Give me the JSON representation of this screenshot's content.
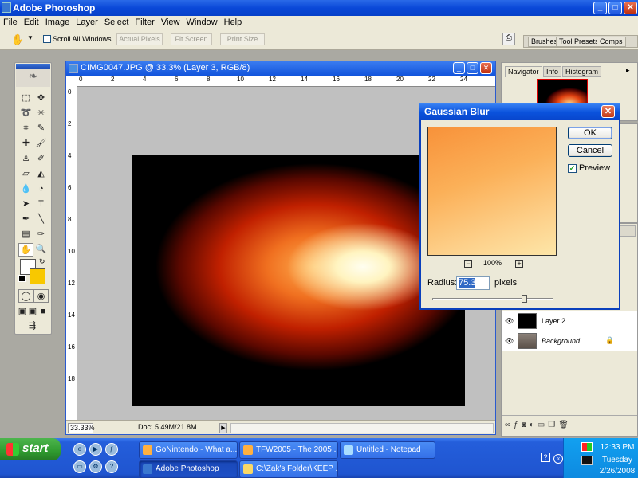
{
  "window": {
    "title": "Adobe Photoshop",
    "min": "_",
    "max": "□",
    "close": "✕"
  },
  "menu": [
    "File",
    "Edit",
    "Image",
    "Layer",
    "Select",
    "Filter",
    "View",
    "Window",
    "Help"
  ],
  "options": {
    "scroll_all": "Scroll All Windows",
    "actual_pixels": "Actual Pixels",
    "fit_screen": "Fit Screen",
    "print_size": "Print Size"
  },
  "palette_well": {
    "tabs": [
      "Brushes",
      "Tool Presets",
      "Comps"
    ]
  },
  "document": {
    "title": "CIMG0047.JPG @ 33.3% (Layer 3, RGB/8)",
    "ruler_h": [
      "0",
      "2",
      "4",
      "6",
      "8",
      "10",
      "12",
      "14",
      "16",
      "18",
      "20",
      "22",
      "24"
    ],
    "ruler_v": [
      "0",
      "2",
      "4",
      "6",
      "8",
      "10",
      "12",
      "14",
      "16",
      "18"
    ],
    "zoom": "33.33%",
    "doc_size": "Doc: 5.49M/21.8M"
  },
  "navigator": {
    "tabs": [
      "Navigator",
      "Info",
      "Histogram"
    ]
  },
  "layers": [
    {
      "name": "Layer 2",
      "thumb_color": "#000000"
    },
    {
      "name": "Background",
      "thumb_color": "#6a6058"
    }
  ],
  "dialog": {
    "title": "Gaussian Blur",
    "ok": "OK",
    "cancel": "Cancel",
    "preview_label": "Preview",
    "preview_checked": true,
    "zoom": "100%",
    "zoom_out": "−",
    "zoom_in": "+",
    "radius_label": "Radius:",
    "radius_value": "75.3",
    "radius_units": "pixels",
    "slider_level": 0.78
  },
  "taskbar": {
    "start": "start",
    "row1": [
      "GoNintendo - What a...",
      "TFW2005 - The 2005 ...",
      "Untitled - Notepad"
    ],
    "row2": [
      "Adobe Photoshop",
      "C:\\Zak's Folder\\KEEP ..."
    ],
    "active": "Adobe Photoshop",
    "time": "12:33 PM",
    "day": "Tuesday",
    "date": "2/26/2008"
  }
}
